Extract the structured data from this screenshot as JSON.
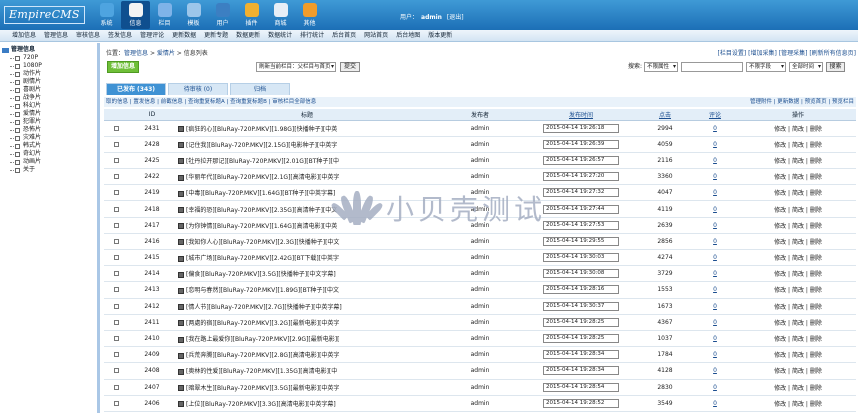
{
  "header": {
    "logo": "EmpireCMS",
    "nav": [
      {
        "label": "系统",
        "icon": "system-icon",
        "color": "#4ea4e0"
      },
      {
        "label": "信息",
        "icon": "info-icon",
        "color": "#f3f3f3"
      },
      {
        "label": "栏目",
        "icon": "column-icon",
        "color": "#7fb3e8"
      },
      {
        "label": "模板",
        "icon": "template-icon",
        "color": "#9cc6ea"
      },
      {
        "label": "用户",
        "icon": "user-icon",
        "color": "#3c7fc2"
      },
      {
        "label": "插件",
        "icon": "plugin-icon",
        "color": "#f0b030"
      },
      {
        "label": "商城",
        "icon": "shop-icon",
        "color": "#e7eef6"
      },
      {
        "label": "其他",
        "icon": "other-icon",
        "color": "#f09c2a"
      }
    ],
    "user_label": "用户：",
    "user_name": "admin",
    "logout": "[退出]"
  },
  "subnav": [
    "增加信息",
    "管理信息",
    "审核信息",
    "签发信息",
    "管理评论",
    "更新数据",
    "更新专题",
    "数据更新",
    "数据统计",
    "排行统计",
    "后台首页",
    "网站首页",
    "后台地图",
    "版本更新"
  ],
  "sidebar": {
    "root": "管理信息",
    "items": [
      "720P",
      "1080P",
      "动作片",
      "剧情片",
      "喜剧片",
      "战争片",
      "科幻片",
      "爱情片",
      "犯罪片",
      "恐怖片",
      "灾难片",
      "韩式片",
      "奇幻片",
      "动画片",
      "关于"
    ]
  },
  "breadcrumb": {
    "prefix": "位置：",
    "link1": "管理信息",
    "sep1": " > ",
    "link2": "爱情片",
    "sep2": " > ",
    "current": "信息列表"
  },
  "topright": "[栏目设置] [增加采集] [管理采集] [刷新所有信息页]",
  "toolbar": {
    "add_button": "增加信息",
    "refresh_select": "刷新当前栏目：父栏目与首页",
    "refresh_button": "提交",
    "search_label": "搜索:",
    "search_type": "不限属性",
    "search_field": "不限字段",
    "search_time": "全部时间",
    "search_button": "搜索"
  },
  "tabs": [
    "已发布 (343)",
    "待审核 (0)",
    "归档"
  ],
  "subbar": {
    "left": "取的信息 | 置发信息 | 前截信息 | 查询重复标题A | 查询重复标题B | 审核栏目全部信息",
    "right": "管理附件 | 更新数据 | 预览首页 | 预览栏目"
  },
  "table": {
    "headers": {
      "id": "ID",
      "title": "标题",
      "publisher": "发布者",
      "time": "发布时间",
      "clicks": "点击",
      "comments": "评论",
      "ops": "操作"
    },
    "ops": {
      "edit": "修改",
      "sep": " | ",
      "copy": "简改",
      "delete": "删除"
    },
    "rows": [
      {
        "id": "2431",
        "title": "[疯狂的心][BluRay-720P.MKV][1.98G][快播种子][中英",
        "publisher": "admin",
        "time": "2015-04-14 19:26:18",
        "clicks": "2994",
        "comments": "0"
      },
      {
        "id": "2428",
        "title": "[记住我][BluRay-720P.MKV][2.15G][电影种子][中英字",
        "publisher": "admin",
        "time": "2015-04-14 19:26:39",
        "clicks": "4059",
        "comments": "0"
      },
      {
        "id": "2425",
        "title": "[牡丹拉开那记][BluRay-720P.MKV][2.01G][BT种子][中",
        "publisher": "admin",
        "time": "2015-04-14 19:26:57",
        "clicks": "2116",
        "comments": "0"
      },
      {
        "id": "2422",
        "title": "[华丽年代][BluRay-720P.MKV][2.1G][高清电影][中英字",
        "publisher": "admin",
        "time": "2015-04-14 19:27:20",
        "clicks": "3360",
        "comments": "0"
      },
      {
        "id": "2419",
        "title": "[中毒][BluRay-720P.MKV][1.64G][BT种子][中英字幕]",
        "publisher": "admin",
        "time": "2015-04-14 19:27:32",
        "clicks": "4047",
        "comments": "0"
      },
      {
        "id": "2418",
        "title": "[幸福的恐][BluRay-720P.MKV][2.35G][高清种子][中文",
        "publisher": "admin",
        "time": "2015-04-14 19:27:44",
        "clicks": "4119",
        "comments": "0"
      },
      {
        "id": "2417",
        "title": "[为你钟情][BluRay-720P.MKV][1.64G][高清电影][中英",
        "publisher": "admin",
        "time": "2015-04-14 19:27:53",
        "clicks": "2639",
        "comments": "0"
      },
      {
        "id": "2416",
        "title": "[我知你人心][BluRay-720P.MKV][2.3G][快播种子][中文",
        "publisher": "admin",
        "time": "2015-04-14 19:29:55",
        "clicks": "2856",
        "comments": "0"
      },
      {
        "id": "2415",
        "title": "[城市广场][BluRay-720P.MKV][2.42G][BT下载][中英字",
        "publisher": "admin",
        "time": "2015-04-14 19:30:03",
        "clicks": "4274",
        "comments": "0"
      },
      {
        "id": "2414",
        "title": "[偏食][BluRay-720P.MKV][3.5G][快播种子][中文字幕]",
        "publisher": "admin",
        "time": "2015-04-14 19:30:08",
        "clicks": "3729",
        "comments": "0"
      },
      {
        "id": "2413",
        "title": "[恋明与春然][BluRay-720P.MKV][1.89G][BT种子][中文",
        "publisher": "admin",
        "time": "2015-04-14 19:28:16",
        "clicks": "1553",
        "comments": "0"
      },
      {
        "id": "2412",
        "title": "[情人节][BluRay-720P.MKV][2.7G][快播种子][中英字幕]",
        "publisher": "admin",
        "time": "2015-04-14 19:30:37",
        "clicks": "1673",
        "comments": "0"
      },
      {
        "id": "2411",
        "title": "[两處的宿][BluRay-720P.MKV][3.2G][最新电影][中英字",
        "publisher": "admin",
        "time": "2015-04-14 19:28:25",
        "clicks": "4367",
        "comments": "0"
      },
      {
        "id": "2410",
        "title": "[我在路上最爱你][BluRay-720P.MKV][2.9G][最新电影][",
        "publisher": "admin",
        "time": "2015-04-14 19:28:25",
        "clicks": "1037",
        "comments": "0"
      },
      {
        "id": "2409",
        "title": "[兵荒奔腾][BluRay-720P.MKV][2.8G][高清电影][中英字",
        "publisher": "admin",
        "time": "2015-04-14 19:28:34",
        "clicks": "1784",
        "comments": "0"
      },
      {
        "id": "2408",
        "title": "[奥林的性爱][BluRay-720P.MKV][1.35G][高清电影][中",
        "publisher": "admin",
        "time": "2015-04-14 19:28:34",
        "clicks": "4128",
        "comments": "0"
      },
      {
        "id": "2407",
        "title": "[暗翠木生][BluRay-720P.MKV][3.5G][最新电影][中英字",
        "publisher": "admin",
        "time": "2015-04-14 19:28:54",
        "clicks": "2830",
        "comments": "0"
      },
      {
        "id": "2406",
        "title": "[上位][BluRay-720P.MKV][3.3G][高清电影][中英字幕]",
        "publisher": "admin",
        "time": "2015-04-14 19:28:52",
        "clicks": "3549",
        "comments": "0"
      }
    ]
  },
  "watermark": "小贝壳测试"
}
